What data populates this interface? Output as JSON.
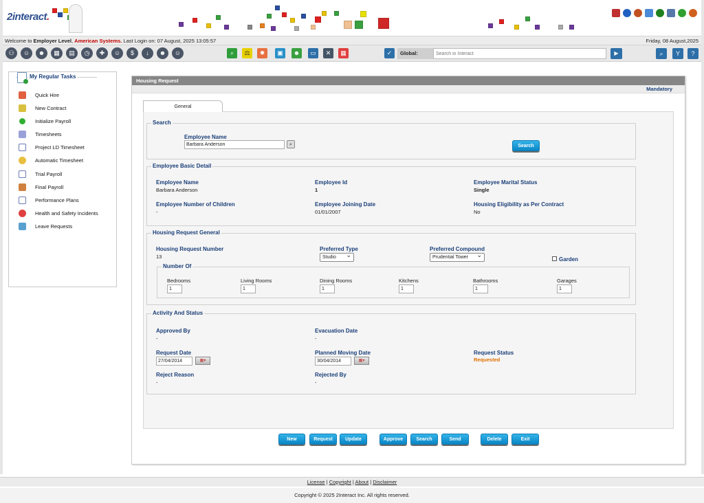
{
  "brand": {
    "logo_text": "2interact",
    "logo_dot": "."
  },
  "welcome": {
    "prefix": "Welcome to ",
    "level": "Employer Level",
    "comma": ", ",
    "company": "American Systems.",
    "last_login": " Last Login on: 07 August, 2025 13:05:57",
    "today": "Friday, 08 August,2025"
  },
  "global_search": {
    "label": "Global:",
    "placeholder": "Search in Interact"
  },
  "sidebar": {
    "title": "My Regular Tasks",
    "items": [
      {
        "label": "Quick Hire",
        "icon": "quick-hire-icon"
      },
      {
        "label": "New Contract",
        "icon": "new-contract-icon"
      },
      {
        "label": "Initialize Payroll",
        "icon": "initialize-payroll-icon"
      },
      {
        "label": "Timesheets",
        "icon": "timesheets-icon"
      },
      {
        "label": "Project LD Timesheet",
        "icon": "project-timesheet-icon"
      },
      {
        "label": "Automatic Timesheet",
        "icon": "automatic-timesheet-icon"
      },
      {
        "label": "Trial Payroll",
        "icon": "trial-payroll-icon"
      },
      {
        "label": "Final Payroll",
        "icon": "final-payroll-icon"
      },
      {
        "label": "Performance Plans",
        "icon": "performance-plans-icon"
      },
      {
        "label": "Health and Safety Incidents",
        "icon": "health-safety-icon"
      },
      {
        "label": "Leave Requests",
        "icon": "leave-requests-icon"
      }
    ]
  },
  "main": {
    "title": "Housing Request",
    "mandatory": "Mandatory",
    "tab": "General",
    "search_section": {
      "title": "Search",
      "employee_name_label": "Employee Name",
      "employee_name_value": "Barbara Anderson",
      "search_button": "Search"
    },
    "basic": {
      "title": "Employee Basic Detail",
      "name_label": "Employee Name",
      "name_value": "Barbara Anderson",
      "id_label": "Employee Id",
      "id_value": "1",
      "marital_label": "Employee Marital Status",
      "marital_value": "Single",
      "children_label": "Employee Number of Children",
      "children_value": "-",
      "joining_label": "Employee Joining Date",
      "joining_value": "01/01/2007",
      "eligibility_label": "Housing Eligibility as Per Contract",
      "eligibility_value": "No"
    },
    "housing": {
      "title": "Housing Request General",
      "number_label": "Housing Request Number",
      "number_value": "13",
      "type_label": "Preferred Type",
      "type_value": "Studio",
      "compound_label": "Preferred Compound",
      "compound_value": "Prudential Tower",
      "garden_label": "Garden",
      "number_of_title": "Number Of",
      "rooms": [
        {
          "label": "Bedrooms",
          "value": "1"
        },
        {
          "label": "Living Rooms",
          "value": "1"
        },
        {
          "label": "Dining Rooms",
          "value": "1"
        },
        {
          "label": "Kitchens",
          "value": "1"
        },
        {
          "label": "Bathrooms",
          "value": "1"
        },
        {
          "label": "Garages",
          "value": "1"
        }
      ]
    },
    "activity": {
      "title": "Activity And Status",
      "approved_label": "Approved By",
      "approved_value": "-",
      "evac_label": "Evacuation Date",
      "evac_value": "-",
      "request_date_label": "Request Date",
      "request_date_value": "27/04/2014",
      "moving_label": "Planned Moving Date",
      "moving_value": "30/04/2014",
      "status_label": "Request Status",
      "status_value": "Requested",
      "reject_label": "Reject Reason",
      "reject_value": "-",
      "rejected_by_label": "Rejected By",
      "rejected_by_value": "-"
    },
    "buttons": {
      "new": "New",
      "request": "Request",
      "update": "Update",
      "approve": "Approve",
      "search": "Search",
      "send": "Send",
      "delete": "Delete",
      "exit": "Exit"
    }
  },
  "footer": {
    "license": "License",
    "copyright": "Copyright",
    "about": "About",
    "disclaimer": "Disclaimer",
    "sep": " | ",
    "copy": "Copyright © 2025 2Interact Inc. All rights reserved."
  },
  "colors": {
    "accent": "#1a3f78",
    "button": "#0a86c6",
    "status": "#e07000",
    "company": "#c00000"
  }
}
